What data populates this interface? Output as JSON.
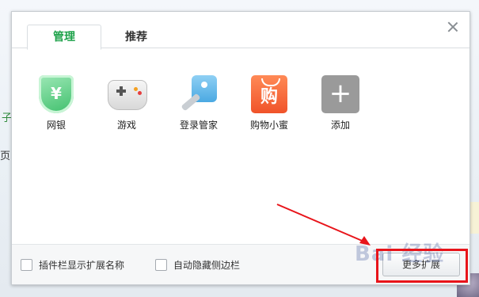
{
  "tabs": [
    {
      "label": "管理",
      "active": true
    },
    {
      "label": "推荐",
      "active": false
    }
  ],
  "apps": [
    {
      "label": "网银",
      "icon": "shield-yen-icon",
      "glyph": "¥"
    },
    {
      "label": "游戏",
      "icon": "gamepad-icon"
    },
    {
      "label": "登录管家",
      "icon": "key-icon"
    },
    {
      "label": "购物小蜜",
      "icon": "shopping-bag-icon",
      "glyph": "购"
    },
    {
      "label": "添加",
      "icon": "plus-icon",
      "glyph": "+"
    }
  ],
  "footer": {
    "show_names": "插件栏显示扩展名称",
    "auto_hide": "自动隐藏侧边栏",
    "more_button": "更多扩展"
  },
  "background": {
    "fragment1": "子",
    "fragment2": "页",
    "watermark": "Bai 经验"
  },
  "colors": {
    "accent": "#1ea24a",
    "annotation": "#e8141a"
  }
}
